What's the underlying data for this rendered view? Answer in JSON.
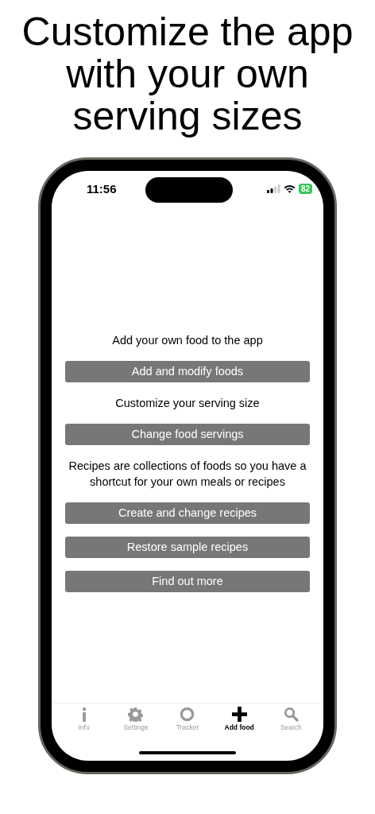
{
  "headline": "Customize the app with your own serving sizes",
  "status_bar": {
    "time": "11:56",
    "battery": "82"
  },
  "content": [
    {
      "kind": "text",
      "text": "Add your own food to the app"
    },
    {
      "kind": "button",
      "text": "Add and modify foods"
    },
    {
      "kind": "text",
      "text": "Customize your serving size"
    },
    {
      "kind": "button",
      "text": "Change food servings"
    },
    {
      "kind": "text",
      "text": "Recipes are collections of foods so you have a shortcut for your own meals or recipes"
    },
    {
      "kind": "button",
      "text": "Create and change recipes"
    },
    {
      "kind": "button",
      "text": "Restore sample recipes"
    },
    {
      "kind": "button",
      "text": "Find out more"
    }
  ],
  "tabs": [
    {
      "label": "Info",
      "kind": "info",
      "selected": false
    },
    {
      "label": "Settings",
      "kind": "gear",
      "selected": false
    },
    {
      "label": "Tracker",
      "kind": "ring",
      "selected": false
    },
    {
      "label": "Add food",
      "kind": "plus",
      "selected": true
    },
    {
      "label": "Search",
      "kind": "search",
      "selected": false
    }
  ]
}
